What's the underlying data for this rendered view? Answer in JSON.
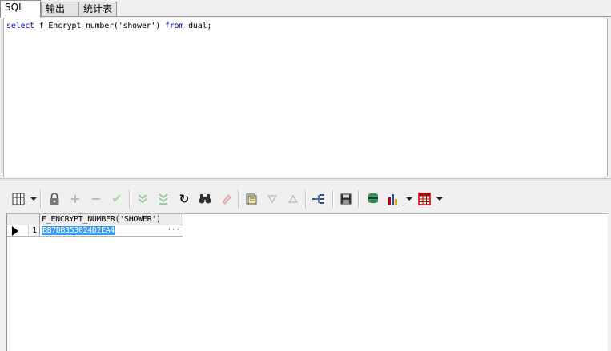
{
  "tabs": [
    {
      "label": "SQL"
    },
    {
      "label": "输出"
    },
    {
      "label": "统计表"
    }
  ],
  "editor": {
    "sql": {
      "kw_select": "select",
      "func_call": " f_Encrypt_number(",
      "arg": "'shower'",
      "close_paren": ") ",
      "kw_from": "from",
      "tail": " dual;"
    }
  },
  "toolbar": {
    "items": [
      {
        "name": "grid-view-icon",
        "glyph": "▦",
        "enabled": true
      },
      {
        "name": "lock-icon",
        "glyph": "🔒",
        "enabled": true
      },
      {
        "name": "insert-record-icon",
        "glyph": "+",
        "enabled": false
      },
      {
        "name": "delete-record-icon",
        "glyph": "−",
        "enabled": false
      },
      {
        "name": "post-changes-icon",
        "glyph": "✔",
        "enabled": false
      },
      {
        "name": "fetch-next-icon",
        "glyph": "⏬",
        "enabled": false
      },
      {
        "name": "fetch-all-icon",
        "glyph": "⏬",
        "enabled": false
      },
      {
        "name": "refresh-icon",
        "glyph": "↻",
        "enabled": true
      },
      {
        "name": "find-icon",
        "glyph": "🔍",
        "enabled": true
      },
      {
        "name": "clear-icon",
        "glyph": "✎",
        "enabled": false
      },
      {
        "name": "query-by-example-icon",
        "glyph": "🗎",
        "enabled": true
      },
      {
        "name": "next-record-icon",
        "glyph": "▽",
        "enabled": false
      },
      {
        "name": "previous-record-icon",
        "glyph": "△",
        "enabled": false
      },
      {
        "name": "record-tree-icon",
        "glyph": "⊞",
        "enabled": true
      },
      {
        "name": "save-icon",
        "glyph": "💾",
        "enabled": true
      },
      {
        "name": "export-icon",
        "glyph": "⛁",
        "enabled": true
      },
      {
        "name": "chart-icon",
        "glyph": "📊",
        "enabled": true
      },
      {
        "name": "table-icon",
        "glyph": "▤",
        "enabled": true
      }
    ]
  },
  "results": {
    "columns": [
      "",
      "F_ENCRYPT_NUMBER('SHOWER')"
    ],
    "rows": [
      {
        "num": "1",
        "values": [
          "BB7DB353024D2EA4"
        ],
        "ellipsis": "···"
      }
    ]
  },
  "colors": {
    "keyword": "#0000c8",
    "selection": "#3399ff",
    "red_icon": "#c00000",
    "green_icon": "#2e8b57"
  }
}
